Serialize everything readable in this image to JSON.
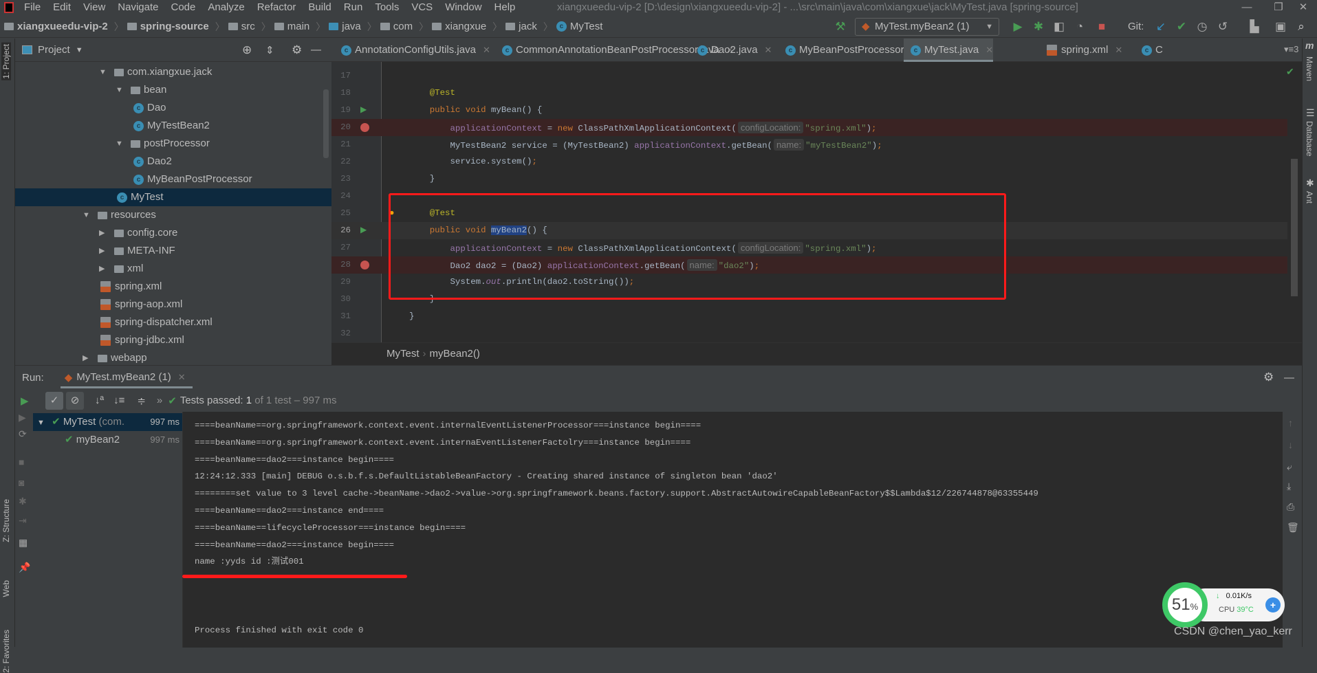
{
  "menu": [
    "File",
    "Edit",
    "View",
    "Navigate",
    "Code",
    "Analyze",
    "Refactor",
    "Build",
    "Run",
    "Tools",
    "VCS",
    "Window",
    "Help"
  ],
  "window_title": "xiangxueedu-vip-2 [D:\\design\\xiangxueedu-vip-2] - ...\\src\\main\\java\\com\\xiangxue\\jack\\MyTest.java [spring-source]",
  "breadcrumb": [
    "xiangxueedu-vip-2",
    "spring-source",
    "src",
    "main",
    "java",
    "com",
    "xiangxue",
    "jack",
    "MyTest"
  ],
  "run_config": "MyTest.myBean2 (1)",
  "git_label": "Git:",
  "project_panel": {
    "title": "Project",
    "stripe_label": "1: Project",
    "tree": [
      {
        "label": "com.xiangxue.jack",
        "level": 1,
        "type": "package",
        "expanded": true
      },
      {
        "label": "bean",
        "level": 2,
        "type": "package",
        "expanded": true
      },
      {
        "label": "Dao",
        "level": 3,
        "type": "class"
      },
      {
        "label": "MyTestBean2",
        "level": 3,
        "type": "class"
      },
      {
        "label": "postProcessor",
        "level": 2,
        "type": "package",
        "expanded": true
      },
      {
        "label": "Dao2",
        "level": 3,
        "type": "class"
      },
      {
        "label": "MyBeanPostProcessor",
        "level": 3,
        "type": "class"
      },
      {
        "label": "MyTest",
        "level": 2,
        "type": "class",
        "selected": true
      },
      {
        "label": "resources",
        "level": 0,
        "type": "folder",
        "expanded": true
      },
      {
        "label": "config.core",
        "level": 1,
        "type": "package",
        "expanded": false
      },
      {
        "label": "META-INF",
        "level": 1,
        "type": "package",
        "expanded": false
      },
      {
        "label": "xml",
        "level": 1,
        "type": "package",
        "expanded": false
      },
      {
        "label": "spring.xml",
        "level": 1,
        "type": "xml"
      },
      {
        "label": "spring-aop.xml",
        "level": 1,
        "type": "xml"
      },
      {
        "label": "spring-dispatcher.xml",
        "level": 1,
        "type": "xml"
      },
      {
        "label": "spring-jdbc.xml",
        "level": 1,
        "type": "xml"
      },
      {
        "label": "webapp",
        "level": 0,
        "type": "folder",
        "expanded": false
      }
    ]
  },
  "editor_tabs": [
    {
      "label": "AnnotationConfigUtils.java"
    },
    {
      "label": "CommonAnnotationBeanPostProcessor.java"
    },
    {
      "label": "Dao2.java"
    },
    {
      "label": "MyBeanPostProcessor.java"
    },
    {
      "label": "MyTest.java",
      "active": true
    },
    {
      "label": "spring.xml"
    },
    {
      "label": "C"
    }
  ],
  "tabs_overflow": "3",
  "code_lines": [
    {
      "n": "17",
      "tokens": []
    },
    {
      "n": "18",
      "tokens": [
        {
          "k": "ann",
          "t": "    @Test"
        }
      ]
    },
    {
      "n": "19",
      "run": true,
      "tokens": [
        {
          "k": "kw",
          "t": "    public void "
        },
        {
          "k": "plain",
          "t": "myBean() {"
        }
      ]
    },
    {
      "n": "20",
      "bp": true,
      "tokens": [
        {
          "k": "field",
          "t": "        applicationContext"
        },
        {
          "k": "plain",
          "t": " = "
        },
        {
          "k": "kw",
          "t": "new "
        },
        {
          "k": "plain",
          "t": "ClassPathXmlApplicationContext("
        },
        {
          "k": "hint",
          "t": "configLocation:"
        },
        {
          "k": "str",
          "t": "\"spring.xml\""
        },
        {
          "k": "plain",
          "t": ")"
        },
        {
          "k": "kw",
          "t": ";"
        }
      ]
    },
    {
      "n": "21",
      "tokens": [
        {
          "k": "plain",
          "t": "        MyTestBean2 service = (MyTestBean2) "
        },
        {
          "k": "field",
          "t": "applicationContext"
        },
        {
          "k": "plain",
          "t": ".getBean("
        },
        {
          "k": "hint",
          "t": "name:"
        },
        {
          "k": "str",
          "t": "\"myTestBean2\""
        },
        {
          "k": "plain",
          "t": ")"
        },
        {
          "k": "kw",
          "t": ";"
        }
      ]
    },
    {
      "n": "22",
      "tokens": [
        {
          "k": "plain",
          "t": "        service.system()"
        },
        {
          "k": "kw",
          "t": ";"
        }
      ]
    },
    {
      "n": "23",
      "tokens": [
        {
          "k": "plain",
          "t": "    }"
        }
      ]
    },
    {
      "n": "24",
      "tokens": []
    },
    {
      "n": "25",
      "bulb": true,
      "tokens": [
        {
          "k": "ann",
          "t": "    @Test"
        }
      ]
    },
    {
      "n": "26",
      "run": true,
      "current": true,
      "tokens": [
        {
          "k": "kw",
          "t": "    public void "
        },
        {
          "k": "sel",
          "t": "myBean2"
        },
        {
          "k": "plain",
          "t": "() {"
        }
      ]
    },
    {
      "n": "27",
      "tokens": [
        {
          "k": "field",
          "t": "        applicationContext"
        },
        {
          "k": "plain",
          "t": " = "
        },
        {
          "k": "kw",
          "t": "new "
        },
        {
          "k": "plain",
          "t": "ClassPathXmlApplicationContext("
        },
        {
          "k": "hint",
          "t": "configLocation:"
        },
        {
          "k": "str",
          "t": "\"spring.xml\""
        },
        {
          "k": "plain",
          "t": ")"
        },
        {
          "k": "kw",
          "t": ";"
        }
      ]
    },
    {
      "n": "28",
      "bp": true,
      "tokens": [
        {
          "k": "plain",
          "t": "        Dao2 dao2 = (Dao2) "
        },
        {
          "k": "field",
          "t": "applicationContext"
        },
        {
          "k": "plain",
          "t": ".getBean("
        },
        {
          "k": "hint",
          "t": "name:"
        },
        {
          "k": "str",
          "t": "\"dao2\""
        },
        {
          "k": "plain",
          "t": ")"
        },
        {
          "k": "kw",
          "t": ";"
        }
      ]
    },
    {
      "n": "29",
      "tokens": [
        {
          "k": "plain",
          "t": "        System."
        },
        {
          "k": "italic",
          "t": "out"
        },
        {
          "k": "plain",
          "t": ".println(dao2.toString())"
        },
        {
          "k": "kw",
          "t": ";"
        }
      ]
    },
    {
      "n": "30",
      "tokens": [
        {
          "k": "plain",
          "t": "    }"
        }
      ]
    },
    {
      "n": "31",
      "tokens": [
        {
          "k": "plain",
          "t": "}"
        }
      ]
    },
    {
      "n": "32",
      "tokens": []
    }
  ],
  "editor_breadcrumb": [
    "MyTest",
    "myBean2()"
  ],
  "run": {
    "label": "Run:",
    "tab": "MyTest.myBean2 (1)",
    "status_prefix": "Tests passed: ",
    "status_count": "1",
    "status_suffix": " of 1 test – 997 ms",
    "tree": [
      {
        "label": "MyTest",
        "detail": " (com.",
        "time": "997 ms"
      },
      {
        "label": "myBean2",
        "time": "997 ms"
      }
    ],
    "console": [
      "====beanName==org.springframework.context.event.internalEventListenerProcessor===instance begin====",
      "====beanName==org.springframework.context.event.internaEventListenerFactolry===instance begin====",
      "====beanName==dao2===instance begin====",
      "12:24:12.333 [main] DEBUG o.s.b.f.s.DefaultListableBeanFactory - Creating shared instance of singleton bean 'dao2'",
      "========set value to 3 level cache->beanName->dao2->value->org.springframework.beans.factory.support.AbstractAutowireCapableBeanFactory$$Lambda$12/226744878@63355449",
      "====beanName==dao2===instance end====",
      "====beanName==lifecycleProcessor===instance begin====",
      "====beanName==dao2===instance begin====",
      "name :yyds id :测试001",
      "",
      "",
      "",
      "Process finished with exit code 0"
    ]
  },
  "left_stripe": [
    "2: Favorites",
    "Web",
    "Z: Structure"
  ],
  "right_stripe": [
    "Maven",
    "Database",
    "Ant"
  ],
  "widget": {
    "percent": "51",
    "unit": "%",
    "net": "0.01K/s",
    "cpu_label": "CPU",
    "cpu_temp": "39°C"
  },
  "watermark": "CSDN @chen_yao_kerr",
  "colors": {
    "annotation_highlight": "#ff1a1a",
    "keyword": "#cc7832",
    "string": "#6a8759",
    "field": "#9876aa",
    "pass": "#499c54"
  }
}
